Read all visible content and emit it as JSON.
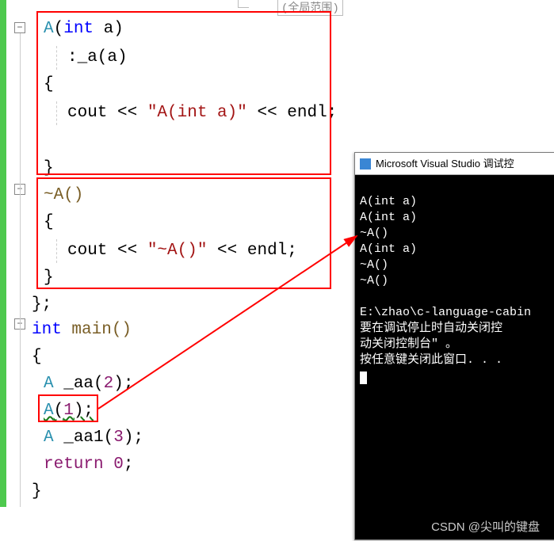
{
  "top_label": "(全局范围)",
  "code": {
    "l1_A": "A",
    "l1_open": "(",
    "l1_int": "int",
    "l1_a": " a)",
    "l2": ":_a(a)",
    "l3": "{",
    "l4_cout": "cout << ",
    "l4_str": "\"A(int a)\"",
    "l4_rest": " << endl;",
    "l6": "}",
    "l7_tilde": "~A()",
    "l8": "{",
    "l9_cout": "cout << ",
    "l9_str": "\"~A()\"",
    "l9_rest": " << endl;",
    "l10": "}",
    "l11": "};",
    "l12_int": "int",
    "l12_main": " main()",
    "l13": "{",
    "l14_A": "A",
    "l14_rest": " _aa(",
    "l14_num": "2",
    "l14_end": ");",
    "l15_A": "A",
    "l15_open": "(",
    "l15_num": "1",
    "l15_end": ");",
    "l16_A": "A",
    "l16_rest": " _aa1(",
    "l16_num": "3",
    "l16_end": ");",
    "l17_ret": "return",
    "l17_sp": " ",
    "l17_num": "0",
    "l17_end": ";",
    "l18": "}"
  },
  "console": {
    "title": "Microsoft Visual Studio 调试控",
    "lines": [
      "A(int a)",
      "A(int a)",
      "~A()",
      "A(int a)",
      "~A()",
      "~A()",
      "",
      "E:\\zhao\\c-language-cabin",
      "要在调试停止时自动关闭控",
      "动关闭控制台\" 。",
      "按任意键关闭此窗口. . ."
    ]
  },
  "watermark": "CSDN @尖叫的键盘"
}
